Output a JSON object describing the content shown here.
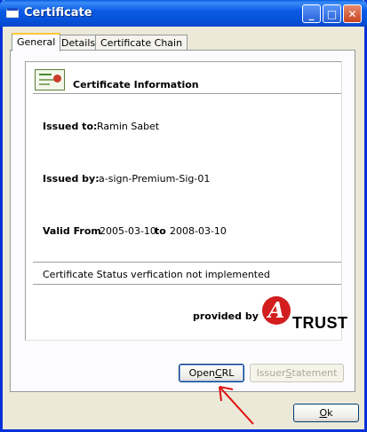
{
  "window": {
    "title": "Certificate",
    "controls": {
      "minimize": "_",
      "maximize": "□",
      "close": "✕"
    }
  },
  "tabs": [
    {
      "label": "General",
      "active": true
    },
    {
      "label": "Details",
      "active": false
    },
    {
      "label": "Certificate Chain",
      "active": false
    }
  ],
  "info": {
    "heading": "Certificate Information",
    "issued_to_label": "Issued to:",
    "issued_to_value": "Ramin Sabet",
    "issued_by_label": "Issued by:",
    "issued_by_value": "a-sign-Premium-Sig-01",
    "valid_from_label": "Valid From",
    "valid_from_value": "2005-03-10",
    "valid_to_label": "to",
    "valid_to_value": "2008-03-10",
    "status_text": "Certificate Status verfication not implemented",
    "provided_by_label": "provided by",
    "logo": {
      "mark": "A",
      "word": "TRUST",
      "color": "#d21e1e"
    }
  },
  "buttons": {
    "open_crl": {
      "pre": "Open ",
      "accel": "C",
      "post": "RL"
    },
    "issuer_statement": {
      "pre": "Issuer ",
      "accel": "S",
      "post": "tatement",
      "enabled": false
    },
    "ok": {
      "pre": "",
      "accel": "O",
      "post": "k"
    }
  },
  "annotation": {
    "arrow_color": "#e01010"
  }
}
